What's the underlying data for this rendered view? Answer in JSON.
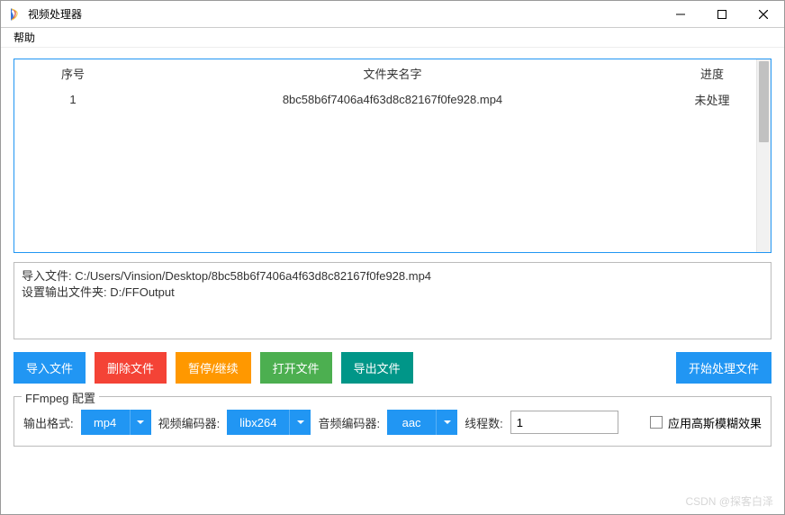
{
  "window": {
    "title": "视频处理器"
  },
  "menu": {
    "help": "帮助"
  },
  "table": {
    "headers": {
      "index": "序号",
      "name": "文件夹名字",
      "progress": "进度"
    },
    "rows": [
      {
        "index": "1",
        "name": "8bc58b6f7406a4f63d8c82167f0fe928.mp4",
        "progress": "未处理"
      }
    ]
  },
  "log": {
    "line1": "导入文件: C:/Users/Vinsion/Desktop/8bc58b6f7406a4f63d8c82167f0fe928.mp4",
    "line2": "设置输出文件夹: D:/FFOutput"
  },
  "buttons": {
    "import": "导入文件",
    "delete": "删除文件",
    "pause_resume": "暂停/继续",
    "open": "打开文件",
    "export": "导出文件",
    "start": "开始处理文件"
  },
  "ffmpeg": {
    "legend": "FFmpeg 配置",
    "output_format_label": "输出格式:",
    "output_format_value": "mp4",
    "video_encoder_label": "视频编码器:",
    "video_encoder_value": "libx264",
    "audio_encoder_label": "音频编码器:",
    "audio_encoder_value": "aac",
    "threads_label": "线程数:",
    "threads_value": "1",
    "gaussian_label": "应用高斯模糊效果"
  },
  "watermark": "CSDN @探客白泽"
}
